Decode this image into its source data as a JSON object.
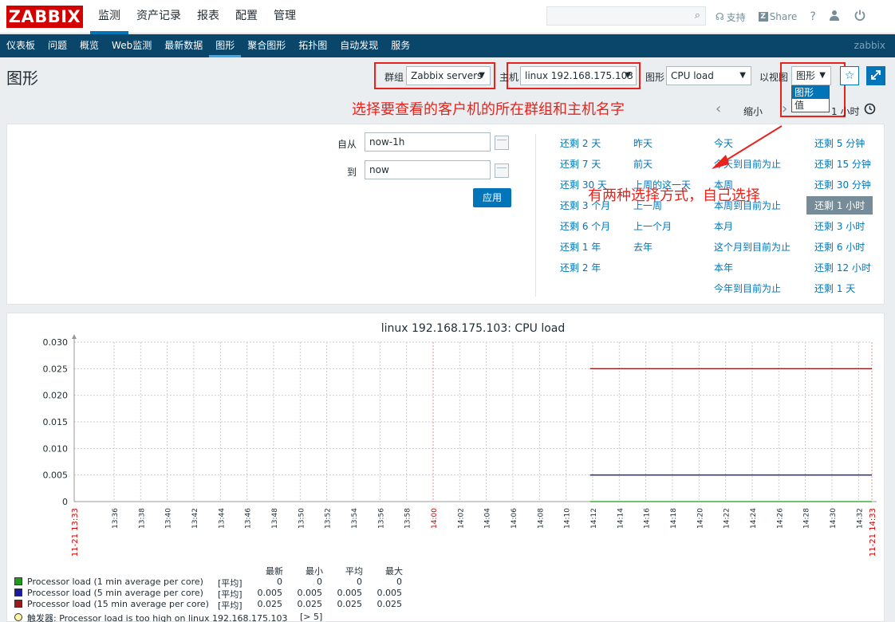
{
  "app": {
    "logo": "ZABBIX",
    "user_label": "zabbix"
  },
  "mainmenu": [
    "监测",
    "资产记录",
    "报表",
    "配置",
    "管理"
  ],
  "toplinks": {
    "support": "支持",
    "share": "Share",
    "help": "?"
  },
  "submenu": [
    "仪表板",
    "问题",
    "概览",
    "Web监测",
    "最新数据",
    "图形",
    "聚合图形",
    "拓扑图",
    "自动发现",
    "服务"
  ],
  "page": {
    "title": "图形"
  },
  "controls": {
    "group_label": "群组",
    "group_value": "Zabbix servers",
    "host_label": "主机",
    "host_value": "linux  192.168.175.103",
    "graph_label": "图形",
    "graph_value": "CPU load",
    "view_label": "以视图",
    "view_value": "图形",
    "view_options": [
      "图形",
      "值"
    ]
  },
  "annotations": {
    "select_hint": "选择要查看的客户机的所在群组和主机名字",
    "view_hint": "有两种选择方式，自己选择"
  },
  "timenav": {
    "zoom_out": "缩小",
    "period": "1 小时"
  },
  "filter": {
    "from_label": "自从",
    "from_value": "now-1h",
    "to_label": "到",
    "to_value": "now",
    "apply": "应用",
    "col1": [
      "还剩 2 天",
      "还剩 7 天",
      "还剩 30 天",
      "还剩 3 个月",
      "还剩 6 个月",
      "还剩 1 年",
      "还剩 2 年"
    ],
    "col2": [
      "昨天",
      "前天",
      "上周的这一天",
      "上一周",
      "上一个月",
      "去年"
    ],
    "col3": [
      "今天",
      "今天到目前为止",
      "本周",
      "本周到目前为止",
      "本月",
      "这个月到目前为止",
      "本年",
      "今年到目前为止"
    ],
    "col4": [
      "还剩 5 分钟",
      "还剩 15 分钟",
      "还剩 30 分钟",
      "还剩 1 小时",
      "还剩 3 小时",
      "还剩 6 小时",
      "还剩 12 小时",
      "还剩 1 天"
    ],
    "col4_selected_index": 3
  },
  "chart_data": {
    "type": "line",
    "title": "linux  192.168.175.103: CPU load",
    "ylim": [
      0,
      0.03
    ],
    "yticks": [
      "0.030",
      "0.025",
      "0.020",
      "0.015",
      "0.010",
      "0.005",
      "0"
    ],
    "xticks": [
      "11-21 13:33",
      "13:36",
      "13:38",
      "13:40",
      "13:42",
      "13:44",
      "13:46",
      "13:48",
      "13:50",
      "13:52",
      "13:54",
      "13:56",
      "13:58",
      "14:00",
      "14:02",
      "14:04",
      "14:06",
      "14:08",
      "14:10",
      "14:12",
      "14:14",
      "14:16",
      "14:18",
      "14:20",
      "14:22",
      "14:24",
      "14:26",
      "14:28",
      "14:30",
      "14:32",
      "11-21 14:33"
    ],
    "xrange_minutes": [
      0,
      60
    ],
    "data_start_minute": 38.8,
    "series": [
      {
        "name": "Processor load (1 min average per core)",
        "color": "#1a9e1a",
        "value": 0
      },
      {
        "name": "Processor load (5 min average per core)",
        "color": "#1a1a9e",
        "value": 0.005
      },
      {
        "name": "Processor load (15 min average per core)",
        "color": "#9e1a1a",
        "value": 0.025
      }
    ],
    "legend_headers": [
      "最新",
      "最小",
      "平均",
      "最大"
    ],
    "legend_rows": [
      {
        "tag": "[平均]",
        "last": "0",
        "min": "0",
        "avg": "0",
        "max": "0"
      },
      {
        "tag": "[平均]",
        "last": "0.005",
        "min": "0.005",
        "avg": "0.005",
        "max": "0.005"
      },
      {
        "tag": "[平均]",
        "last": "0.025",
        "min": "0.025",
        "avg": "0.025",
        "max": "0.025"
      }
    ],
    "trigger_text": "触发器: Processor load is too high on linux  192.168.175.103",
    "trigger_cond": "[> 5]"
  }
}
